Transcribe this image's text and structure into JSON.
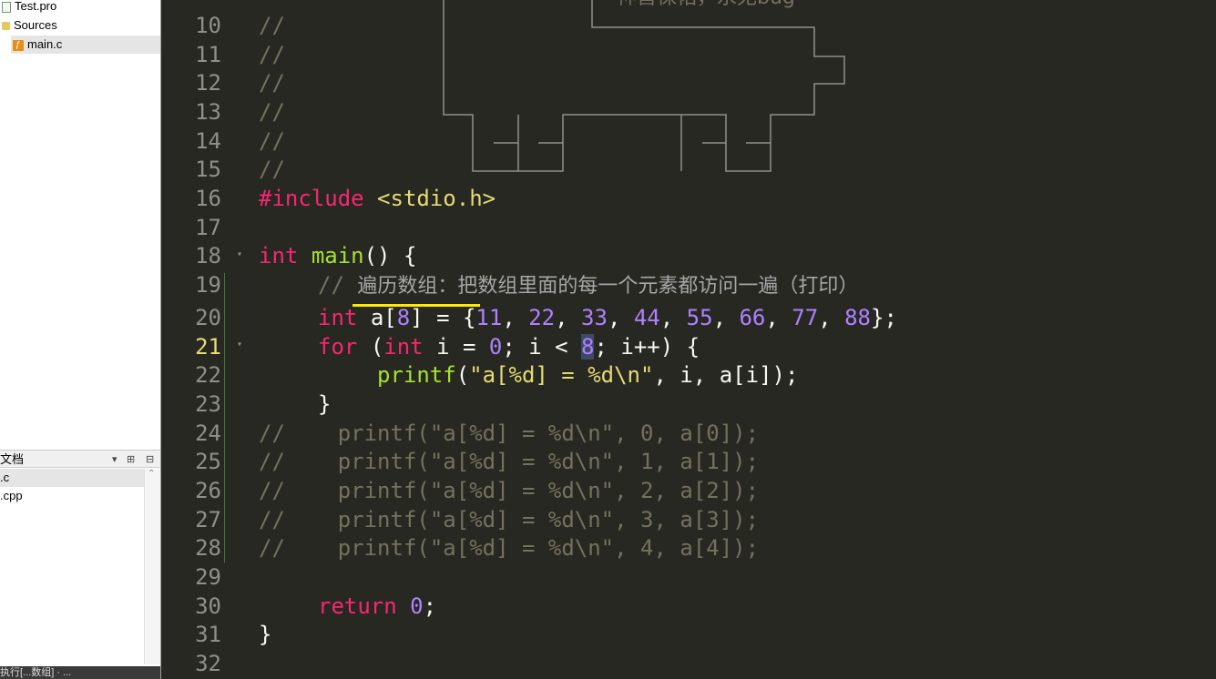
{
  "project_tree": {
    "project_file": "Test.pro",
    "sources_folder": "Sources",
    "source_file": "main.c"
  },
  "documents_panel": {
    "title": "文档",
    "dropdown_icon": "▾",
    "split_icon": "⊞",
    "close_icon": "⊟",
    "items": [
      ".c",
      ".cpp"
    ]
  },
  "status_tip": "执行[...数组] · ...",
  "ascii_art_text": "神兽保佑，永无bug",
  "editor": {
    "current_line": "21",
    "lines": [
      {
        "n": "10"
      },
      {
        "n": "11"
      },
      {
        "n": "12"
      },
      {
        "n": "13"
      },
      {
        "n": "14"
      },
      {
        "n": "15"
      },
      {
        "n": "16"
      },
      {
        "n": "17"
      },
      {
        "n": "18"
      },
      {
        "n": "19"
      },
      {
        "n": "20"
      },
      {
        "n": "21"
      },
      {
        "n": "22"
      },
      {
        "n": "23"
      },
      {
        "n": "24"
      },
      {
        "n": "25"
      },
      {
        "n": "26"
      },
      {
        "n": "27"
      },
      {
        "n": "28"
      },
      {
        "n": "29"
      },
      {
        "n": "30"
      },
      {
        "n": "31"
      },
      {
        "n": "32"
      }
    ],
    "comment_slashes": "//",
    "include_directive": "#include",
    "include_header": "<stdio.h>",
    "kw_int": "int",
    "fn_main": "main",
    "main_tail": "() {",
    "comment_cn_prefix": "// ",
    "comment_cn": "遍历数组：把数组里面的每一个元素都访问一遍（打印）",
    "array_name": "a[",
    "array_size": "8",
    "array_mid": "] = {",
    "array_values": [
      "11",
      "22",
      "33",
      "44",
      "55",
      "66",
      "77",
      "88"
    ],
    "array_end": "};",
    "kw_for": "for",
    "for_open": "(",
    "for_var": " i = ",
    "for_init": "0",
    "for_cond": "; i < ",
    "for_limit": "8",
    "for_tail": "; i++) {",
    "fn_printf": "printf",
    "printf_open": "(",
    "printf_fmt": "\"a[%d] = %d\\n\"",
    "printf_args": ", i, a[i]);",
    "close_brace": "}",
    "commented_printf": [
      "//    printf(\"a[%d] = %d\\n\", 0, a[0]);",
      "//    printf(\"a[%d] = %d\\n\", 1, a[1]);",
      "//    printf(\"a[%d] = %d\\n\", 2, a[2]);",
      "//    printf(\"a[%d] = %d\\n\", 3, a[3]);",
      "//    printf(\"a[%d] = %d\\n\", 4, a[4]);"
    ],
    "kw_return": "return",
    "return_val": "0",
    "semicolon": ";"
  },
  "colors": {
    "background": "#272822",
    "keyword": "#f92672",
    "function": "#a6e22e",
    "number": "#ae81ff",
    "string": "#e6db74",
    "comment": "#75715e",
    "annotation_underline": "#ffe800"
  }
}
